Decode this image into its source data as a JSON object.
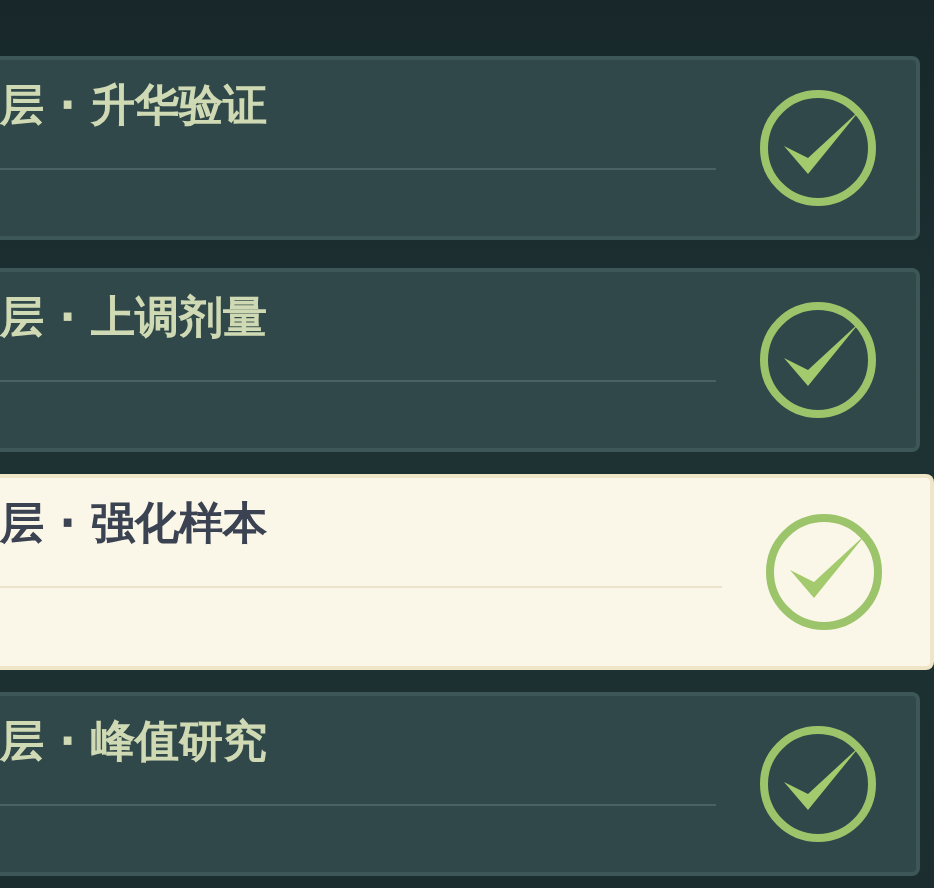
{
  "stages": [
    {
      "title": "层 · 升华验证",
      "selected": false,
      "completed": true
    },
    {
      "title": "层 · 上调剂量",
      "selected": false,
      "completed": true
    },
    {
      "title": "层 · 强化样本",
      "selected": true,
      "completed": true
    },
    {
      "title": "层 · 峰值研究",
      "selected": false,
      "completed": true
    }
  ]
}
